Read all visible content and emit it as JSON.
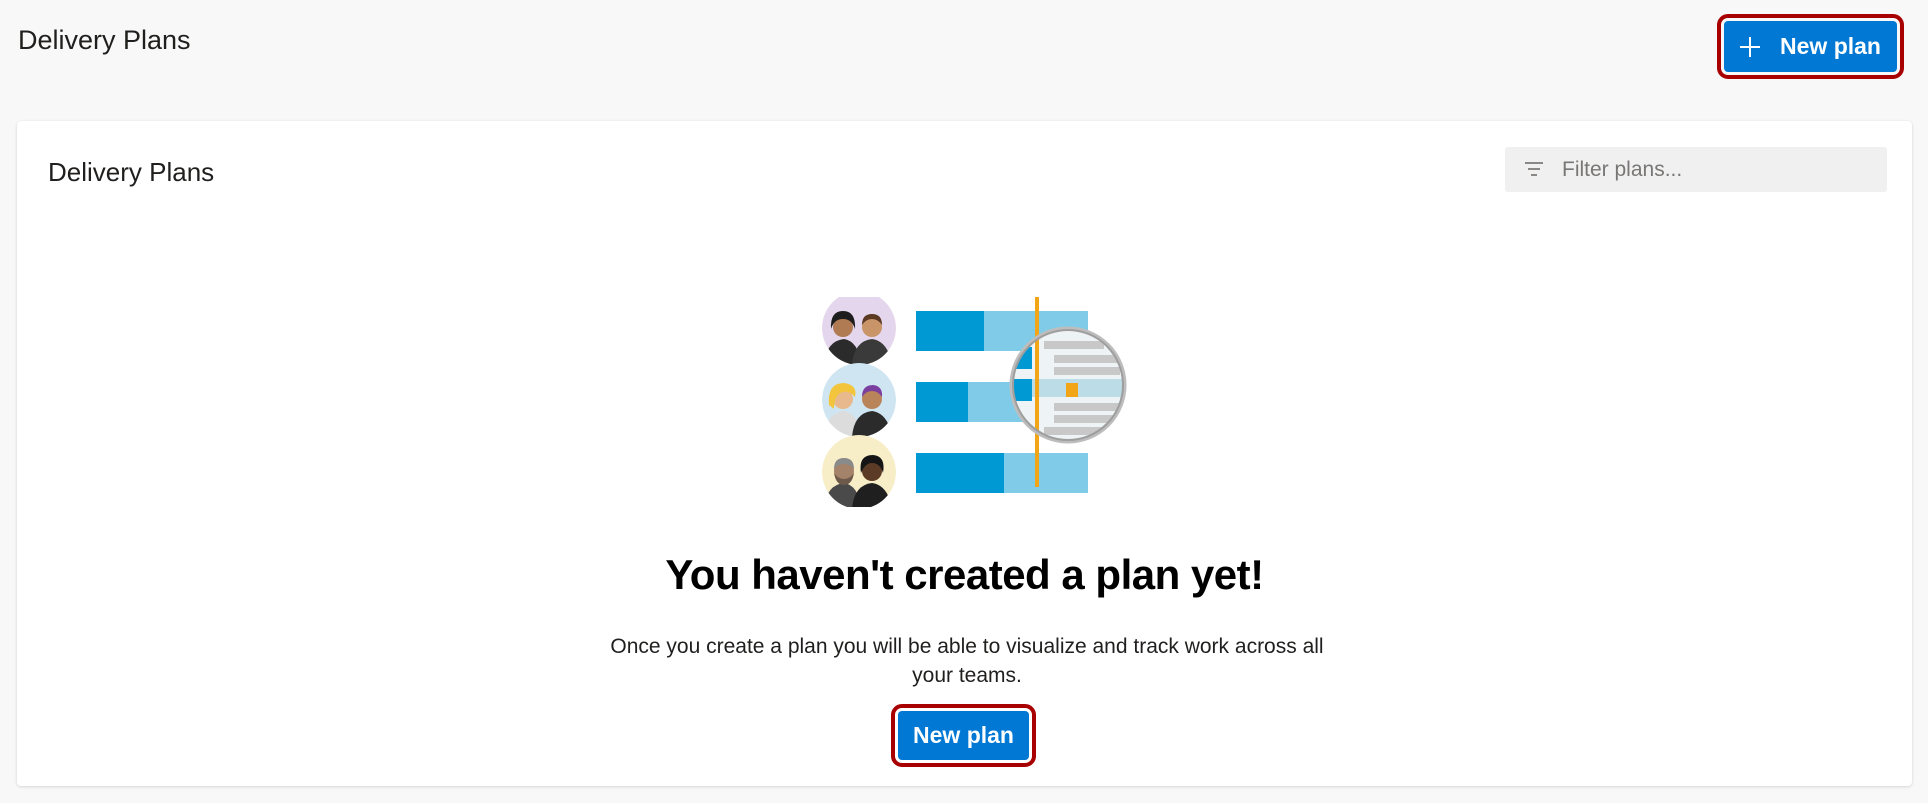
{
  "header": {
    "title": "Delivery Plans",
    "new_plan_label": "New plan"
  },
  "card": {
    "title": "Delivery Plans",
    "filter": {
      "placeholder": "Filter plans...",
      "value": ""
    }
  },
  "empty_state": {
    "title": "You haven't created a plan yet!",
    "description": "Once you create a plan you will be able to visualize and track work across all your teams.",
    "button_label": "New plan"
  },
  "colors": {
    "primary": "#0078d4",
    "highlight_border": "#a80000",
    "bar_dark": "#0099d4",
    "bar_light": "#80cce8",
    "today_line": "#f2a516"
  }
}
